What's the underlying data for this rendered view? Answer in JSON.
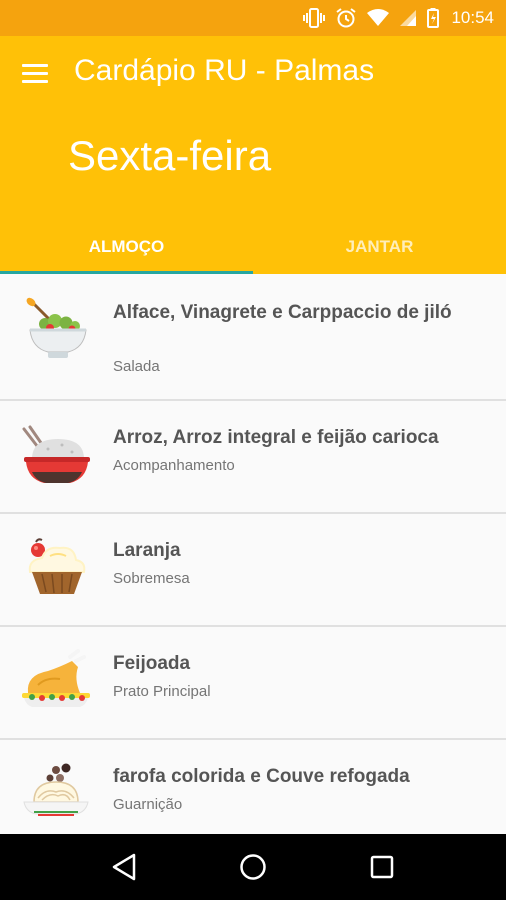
{
  "status_bar": {
    "time": "10:54"
  },
  "app": {
    "title": "Cardápio RU - Palmas"
  },
  "day": {
    "title": "Sexta-feira"
  },
  "tabs": [
    {
      "label": "ALMOÇO",
      "active": true
    },
    {
      "label": "JANTAR",
      "active": false
    }
  ],
  "menu": [
    {
      "name": "Alface, Vinagrete e Carppaccio de jiló",
      "category": "Salada",
      "icon": "salad-bowl-icon"
    },
    {
      "name": "Arroz, Arroz integral e feijão carioca",
      "category": "Acompanhamento",
      "icon": "rice-bowl-icon"
    },
    {
      "name": "Laranja",
      "category": "Sobremesa",
      "icon": "cupcake-icon"
    },
    {
      "name": "Feijoada",
      "category": "Prato Principal",
      "icon": "roast-chicken-icon"
    },
    {
      "name": "farofa colorida e Couve refogada",
      "category": "Guarnição",
      "icon": "pasta-plate-icon"
    }
  ],
  "colors": {
    "status_bar": "#f5a30e",
    "app_bar": "#ffc107",
    "tab_indicator": "#27a7a0"
  }
}
